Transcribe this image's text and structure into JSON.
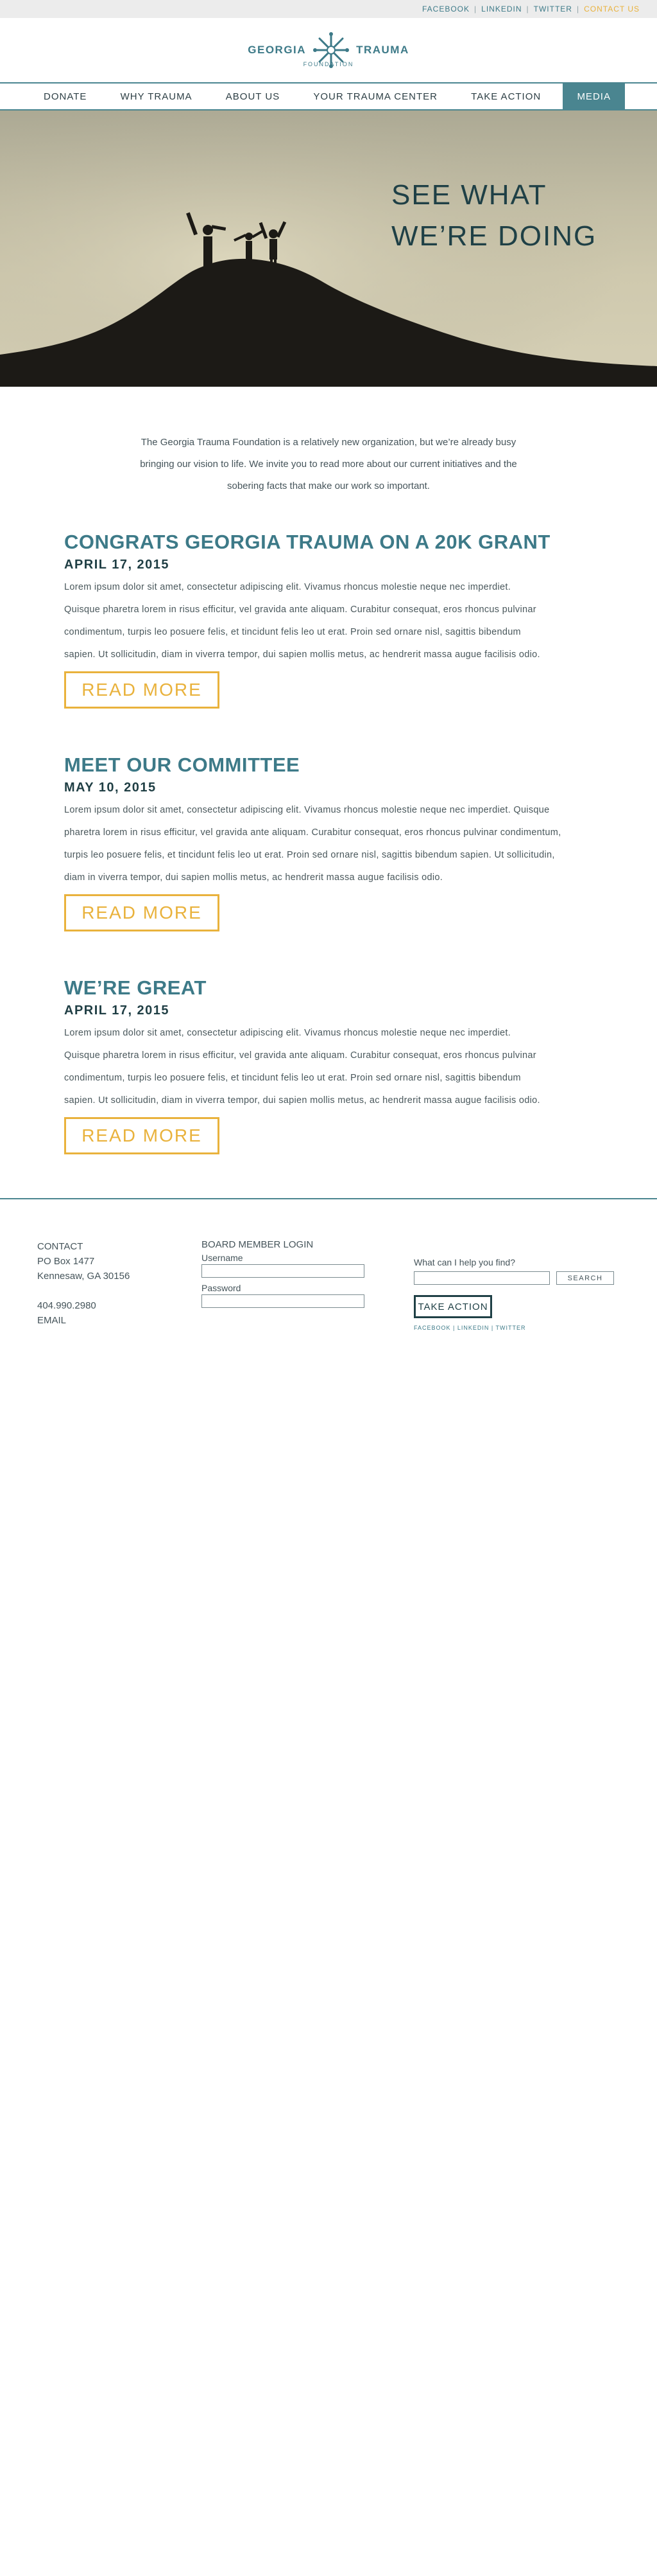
{
  "topbar": {
    "links": [
      "FACEBOOK",
      "LINKEDIN",
      "TWITTER",
      "CONTACT US"
    ],
    "accent_color": "#e9b23c",
    "link_color": "#3d7a88"
  },
  "logo": {
    "left": "GEORGIA",
    "right": "TRAUMA",
    "sub": "FOUNDATION",
    "icon": "star-burst-icon"
  },
  "nav": {
    "items": [
      "DONATE",
      "WHY TRAUMA",
      "ABOUT US",
      "YOUR TRAUMA CENTER",
      "TAKE ACTION",
      "MEDIA"
    ],
    "active": "MEDIA",
    "active_color": "#4a8590"
  },
  "hero": {
    "line1": "SEE WHAT",
    "line2": "WE’RE DOING"
  },
  "intro": {
    "line1": "The Georgia Trauma Foundation is a relatively new organization, but we’re already busy",
    "line2": "bringing our vision to life. We invite you to read more about our current initiatives and the",
    "line3": "sobering facts that make our work so important."
  },
  "posts": [
    {
      "title": "CONGRATS GEORGIA TRAUMA ON A 20K GRANT",
      "date": "APRIL 17, 2015",
      "lines": [
        "Lorem ipsum dolor sit amet, consectetur adipiscing elit. Vivamus rhoncus molestie neque nec imperdiet.",
        "Quisque pharetra lorem in risus efficitur, vel gravida ante aliquam. Curabitur consequat, eros rhoncus pulvinar",
        "condimentum, turpis leo posuere felis, et tincidunt felis leo ut erat. Proin sed ornare nisl, sagittis bibendum",
        "sapien. Ut sollicitudin, diam in viverra tempor, dui sapien mollis metus, ac hendrerit massa augue facilisis odio."
      ],
      "button": "READ MORE"
    },
    {
      "title": "MEET OUR COMMITTEE",
      "date": "MAY 10, 2015",
      "lines": [
        "Lorem ipsum dolor sit amet, consectetur adipiscing elit. Vivamus rhoncus molestie neque nec imperdiet. Quisque",
        "pharetra lorem in risus efficitur, vel gravida ante aliquam. Curabitur consequat, eros rhoncus pulvinar condimentum,",
        "turpis leo posuere felis, et tincidunt felis leo ut erat. Proin sed ornare nisl, sagittis bibendum sapien. Ut sollicitudin,",
        "diam in viverra tempor, dui sapien mollis metus, ac hendrerit massa augue facilisis odio."
      ],
      "button": "READ MORE"
    },
    {
      "title": "WE’RE GREAT",
      "date": "APRIL 17, 2015",
      "lines": [
        "Lorem ipsum dolor sit amet, consectetur adipiscing elit. Vivamus rhoncus molestie neque nec imperdiet.",
        "Quisque pharetra lorem in risus efficitur, vel gravida ante aliquam. Curabitur consequat, eros rhoncus pulvinar",
        "condimentum, turpis leo posuere felis, et tincidunt felis leo ut erat. Proin sed ornare nisl, sagittis bibendum",
        "sapien. Ut sollicitudin, diam in viverra tempor, dui sapien mollis metus, ac hendrerit massa augue facilisis odio."
      ],
      "button": "READ MORE"
    }
  ],
  "footer": {
    "contact_heading": "CONTACT",
    "address1": "PO Box 1477",
    "address2": "Kennesaw, GA 30156",
    "phone": "404.990.2980",
    "email": "EMAIL",
    "login_heading": "BOARD MEMBER LOGIN",
    "username_label": "Username",
    "password_label": "Password",
    "search_label": "What can I help you find?",
    "search_button": "SEARCH",
    "take_action": "TAKE ACTION",
    "social": "FACEBOOK | LINKEDIN | TWITTER"
  }
}
